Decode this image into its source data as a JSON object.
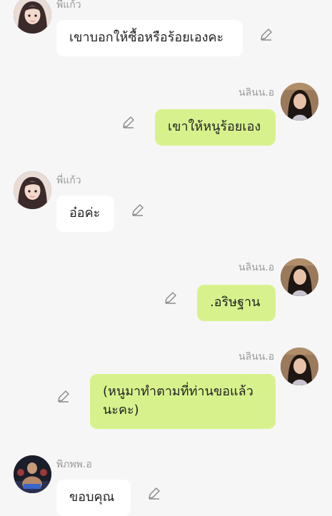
{
  "messages": [
    {
      "sender": "พี่แก้ว",
      "text": "เขาบอกให้ซื้อหรือร้อยเองคะ",
      "side": "left",
      "avatar": "avatar-girl-cartoon"
    },
    {
      "sender": "นลินน.อ",
      "text": "เขาให้หนูร้อยเอง",
      "side": "right",
      "avatar": "avatar-woman-photo"
    },
    {
      "sender": "พี่แก้ว",
      "text": "อ๋อค่ะ",
      "side": "left",
      "avatar": "avatar-girl-cartoon"
    },
    {
      "sender": "นลินน.อ",
      "text": ".อริษฐาน",
      "side": "right",
      "avatar": "avatar-woman-photo"
    },
    {
      "sender": "นลินน.อ",
      "text": "(หนูมาทำตามที่ท่านขอแล้ว นะคะ)",
      "side": "right",
      "avatar": "avatar-woman-photo"
    },
    {
      "sender": "พิภพพ.อ",
      "text": "ขอบคุณ",
      "side": "left",
      "avatar": "avatar-man-fighter"
    }
  ],
  "colors": {
    "background": "#f6f6f6",
    "left_bubble": "#ffffff",
    "right_bubble": "#d7f28d",
    "name_text": "#9a9a9a"
  },
  "icons": {
    "edit": "pencil-edit-icon"
  }
}
